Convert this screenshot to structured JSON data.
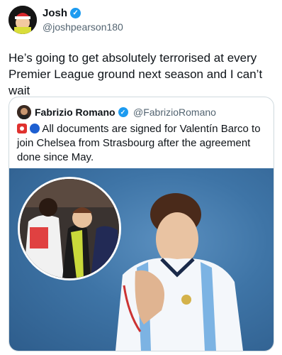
{
  "tweet": {
    "author_name": "Josh",
    "author_handle": "@joshpearson180",
    "text": "He’s going to get absolutely terrorised at every Premier League ground next season and I can’t wait"
  },
  "quoted_tweet": {
    "author_name": "Fabrizio Romano",
    "author_handle": "@FabrizioRomano",
    "text": "All documents are signed for Valentín Barco to join Chelsea from Strasbourg after the agreement done since May.",
    "emoji_icons": [
      "red-badge-emoji",
      "blue-circle-emoji"
    ]
  },
  "colors": {
    "verified_badge": "#1d9bf0",
    "text_primary": "#0f1419",
    "text_secondary": "#536471",
    "card_border": "#cfd9de"
  }
}
